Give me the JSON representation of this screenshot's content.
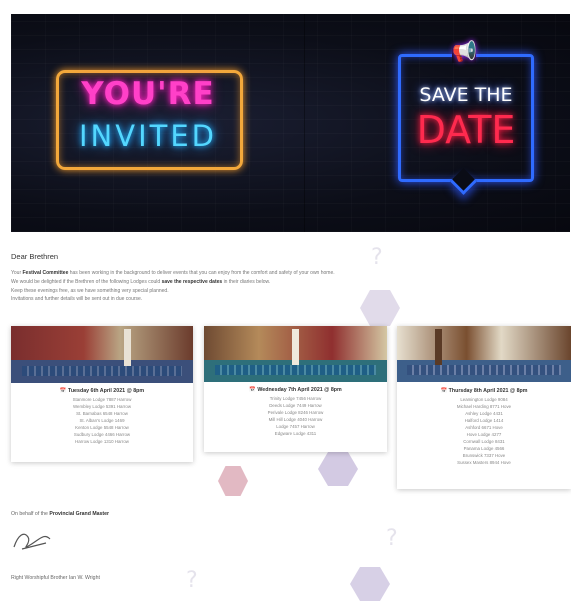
{
  "banner": {
    "invite_top": "YOU'RE",
    "invite_bottom": "INVITED",
    "save_top": "SAVE THE",
    "save_bottom": "DATE"
  },
  "greeting": "Dear Brethren",
  "paragraph": {
    "line1_start": "Your",
    "line1_bold": "Festival Committee",
    "line1_rest": "has been working in the background to deliver events that you can enjoy from the comfort and safety of your own home.",
    "line2_start": "We would be delighted if the Brethren of the following Lodges could",
    "line2_bold": "save the respective dates",
    "line2_rest": "in their diaries below.",
    "line3": "Keep these evenings free, as we have something very special planned.",
    "line4": "Invitations and further details will be sent out in due course."
  },
  "cards": [
    {
      "date": "Tuesday 6th April 2021 @ 8pm",
      "events": [
        "Stanmore Lodge 7887 Harrow",
        "Wembley Lodge 5391 Harrow",
        "St. Barnabas 6548 Harrow",
        "St. Alban's Lodge 1469",
        "Kenton Lodge 5548 Harrow",
        "Sudbury Lodge 4466 Harrow",
        "Harrow Lodge 1310 Harrow"
      ]
    },
    {
      "date": "Wednesday 7th April 2021 @ 8pm",
      "events": [
        "Trinity Lodge 7456 Harrow",
        "Deeds Lodge 7449 Harrow",
        "Perivale Lodge 8246 Harrow",
        "Mill Hill Lodge 4040 Harrow",
        "Lodge 7457 Harrow",
        "Edgware Lodge 4311"
      ]
    },
    {
      "date": "Thursday 8th April 2021 @ 8pm",
      "events": [
        "Leamington Lodge 9084",
        "Michael Harding 8771 Hove",
        "Ashley Lodge 4431",
        "Halford Lodge 1414",
        "Ashford 6671 Hove",
        "Hove Lodge 4277",
        "Cornwall Lodge 8431",
        "Panama Lodge 4566",
        "Brunswick 7337 Hove",
        "Sussex Masters 8944 Hove"
      ]
    }
  ],
  "footer": {
    "behalf_start": "On behalf of the",
    "behalf_bold": "Provincial Grand Master",
    "name": "Right Worshipful Brother Ian W. Wright"
  },
  "colors": {
    "invite_frame": "#f3a83b",
    "invite_top_text": "#ff40c8",
    "invite_bottom_text": "#53d7ff",
    "save_frame": "#2f6bff",
    "save_bottom_text": "#ff2a4e",
    "megaphone": "#b452ff"
  },
  "icons": [
    "megaphone-icon",
    "calendar-icon",
    "signature-mark"
  ]
}
